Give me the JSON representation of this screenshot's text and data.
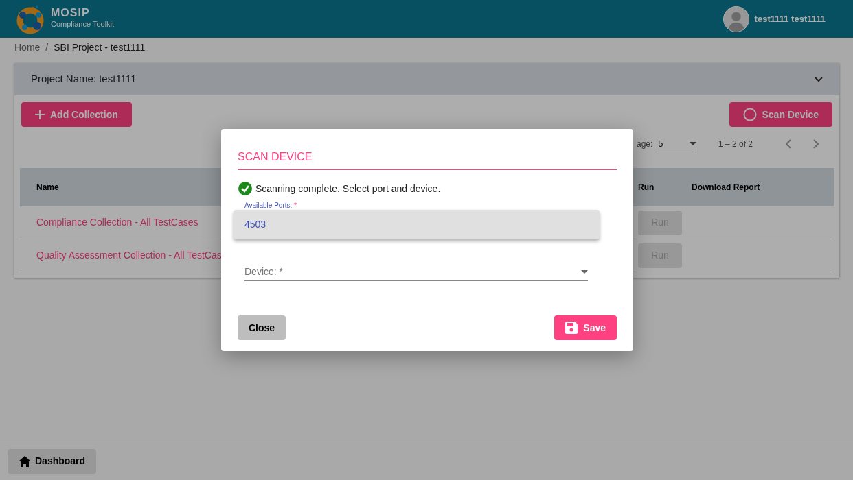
{
  "header": {
    "brand": "MOSIP",
    "subtitle": "Compliance Toolkit",
    "user": "test1111 test1111"
  },
  "breadcrumb": [
    {
      "label": "Home"
    },
    {
      "label": "/"
    },
    {
      "label": "SBI Project - test1111"
    }
  ],
  "project": {
    "title": "Project Name: test1111",
    "expanded": false
  },
  "actions": {
    "add_collection": "Add Collection",
    "scan_device": "Scan Device"
  },
  "pagination": {
    "label": "age:",
    "page_size": "5",
    "range": "1 – 2 of 2"
  },
  "table": {
    "columns": [
      "Name",
      "Run",
      "Download Report"
    ],
    "rows": [
      {
        "name": "Compliance Collection - All TestCases",
        "run": "Run",
        "disabled": true
      },
      {
        "name": "Quality Assessment Collection - All TestCas",
        "run": "Run",
        "disabled": true
      }
    ]
  },
  "modal": {
    "title": "SCAN DEVICE",
    "status": "Scanning complete. Select port and device.",
    "ports": {
      "label": "Available Ports: *",
      "options": [
        {
          "label": "4503",
          "selected": false
        }
      ]
    },
    "device": {
      "label": "Device: *"
    },
    "close": "Close",
    "save": "Save"
  },
  "footer": {
    "dashboard": "Dashboard"
  }
}
